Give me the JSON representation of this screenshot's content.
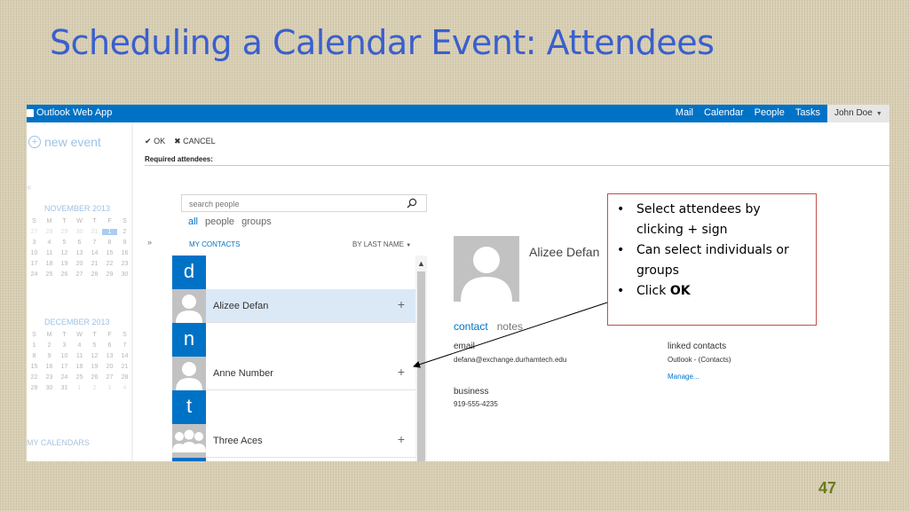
{
  "slide": {
    "title": "Scheduling a Calendar Event: Attendees",
    "page_number": "47"
  },
  "owa": {
    "app_title": "Outlook Web App",
    "nav": [
      "Mail",
      "Calendar",
      "People",
      "Tasks"
    ],
    "user": "John Doe",
    "new_event": "new event",
    "collapse_mark": "«",
    "november": {
      "title": "NOVEMBER 2013",
      "weekdays": [
        "S",
        "M",
        "T",
        "W",
        "T",
        "F",
        "S"
      ],
      "rows": [
        [
          "27",
          "28",
          "29",
          "30",
          "31",
          "1",
          "2"
        ],
        [
          "3",
          "4",
          "5",
          "6",
          "7",
          "8",
          "9"
        ],
        [
          "10",
          "11",
          "12",
          "13",
          "14",
          "15",
          "16"
        ],
        [
          "17",
          "18",
          "19",
          "20",
          "21",
          "22",
          "23"
        ],
        [
          "24",
          "25",
          "26",
          "27",
          "28",
          "29",
          "30"
        ]
      ]
    },
    "december": {
      "title": "DECEMBER 2013",
      "weekdays": [
        "S",
        "M",
        "T",
        "W",
        "T",
        "F",
        "S"
      ],
      "rows": [
        [
          "1",
          "2",
          "3",
          "4",
          "5",
          "6",
          "7"
        ],
        [
          "8",
          "9",
          "10",
          "11",
          "12",
          "13",
          "14"
        ],
        [
          "15",
          "16",
          "17",
          "18",
          "19",
          "20",
          "21"
        ],
        [
          "22",
          "23",
          "24",
          "25",
          "26",
          "27",
          "28"
        ],
        [
          "29",
          "30",
          "31",
          "1",
          "2",
          "3",
          "4"
        ]
      ]
    },
    "my_calendars": "MY CALENDARS",
    "ok": "OK",
    "cancel": "CANCEL",
    "required_attendees": "Required attendees:",
    "search_placeholder": "search people",
    "filters": [
      "all",
      "people",
      "groups"
    ],
    "expand_arrow": "»",
    "my_contacts": "MY CONTACTS",
    "sort_by": "BY LAST NAME",
    "letters": [
      "d",
      "n",
      "t"
    ],
    "contacts": [
      "Alizee Defan",
      "Anne Number",
      "Three Aces"
    ],
    "add_symbol": "+",
    "detail": {
      "name": "Alizee Defan",
      "tab_contact": "contact",
      "tab_notes": "notes",
      "email_label": "email",
      "email": "defana@exchange.durhamtech.edu",
      "business_label": "business",
      "phone": "919-555-4235",
      "linked_label": "linked contacts",
      "linked_value": "Outlook - (Contacts)",
      "manage": "Manage..."
    }
  },
  "callout": {
    "bullet1": "Select attendees by clicking + sign",
    "bullet2": "Can select individuals or groups",
    "bullet3_prefix": "Click ",
    "bullet3_bold": "OK"
  },
  "colors": {
    "title_blue": "#3a5fcd",
    "owa_blue": "#0072c6",
    "page_number": "#6b7a1e",
    "callout_border": "#c0504d"
  }
}
